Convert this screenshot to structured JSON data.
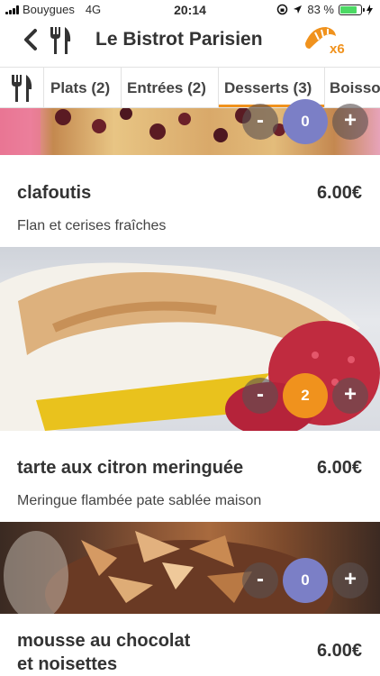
{
  "status_bar": {
    "carrier": "Bouygues",
    "network": "4G",
    "time": "20:14",
    "battery": "83 %",
    "battery_level": 0.83
  },
  "header": {
    "title": "Le Bistrot Parisien",
    "cart_count": "x6"
  },
  "tabs": [
    {
      "label": "Plats (2)",
      "active": false
    },
    {
      "label": "Entrées (2)",
      "active": false
    },
    {
      "label": "Desserts (3)",
      "active": true
    },
    {
      "label": "Boisso",
      "active": false
    }
  ],
  "items": [
    {
      "name": "clafoutis",
      "price": "6.00€",
      "description": "Flan et cerises fraîches",
      "quantity": "0"
    },
    {
      "name": "tarte aux citron meringuée",
      "price": "6.00€",
      "description": "Meringue flambée pate sablée maison",
      "quantity": "2"
    },
    {
      "name": "mousse au chocolat",
      "name_line2": "et noisettes",
      "price": "6.00€",
      "quantity": "0"
    }
  ],
  "stepper": {
    "minus": "-",
    "plus": "+"
  },
  "colors": {
    "accent": "#f0921d",
    "qty_zero": "#7b7fc6",
    "battery": "#4cd964"
  }
}
